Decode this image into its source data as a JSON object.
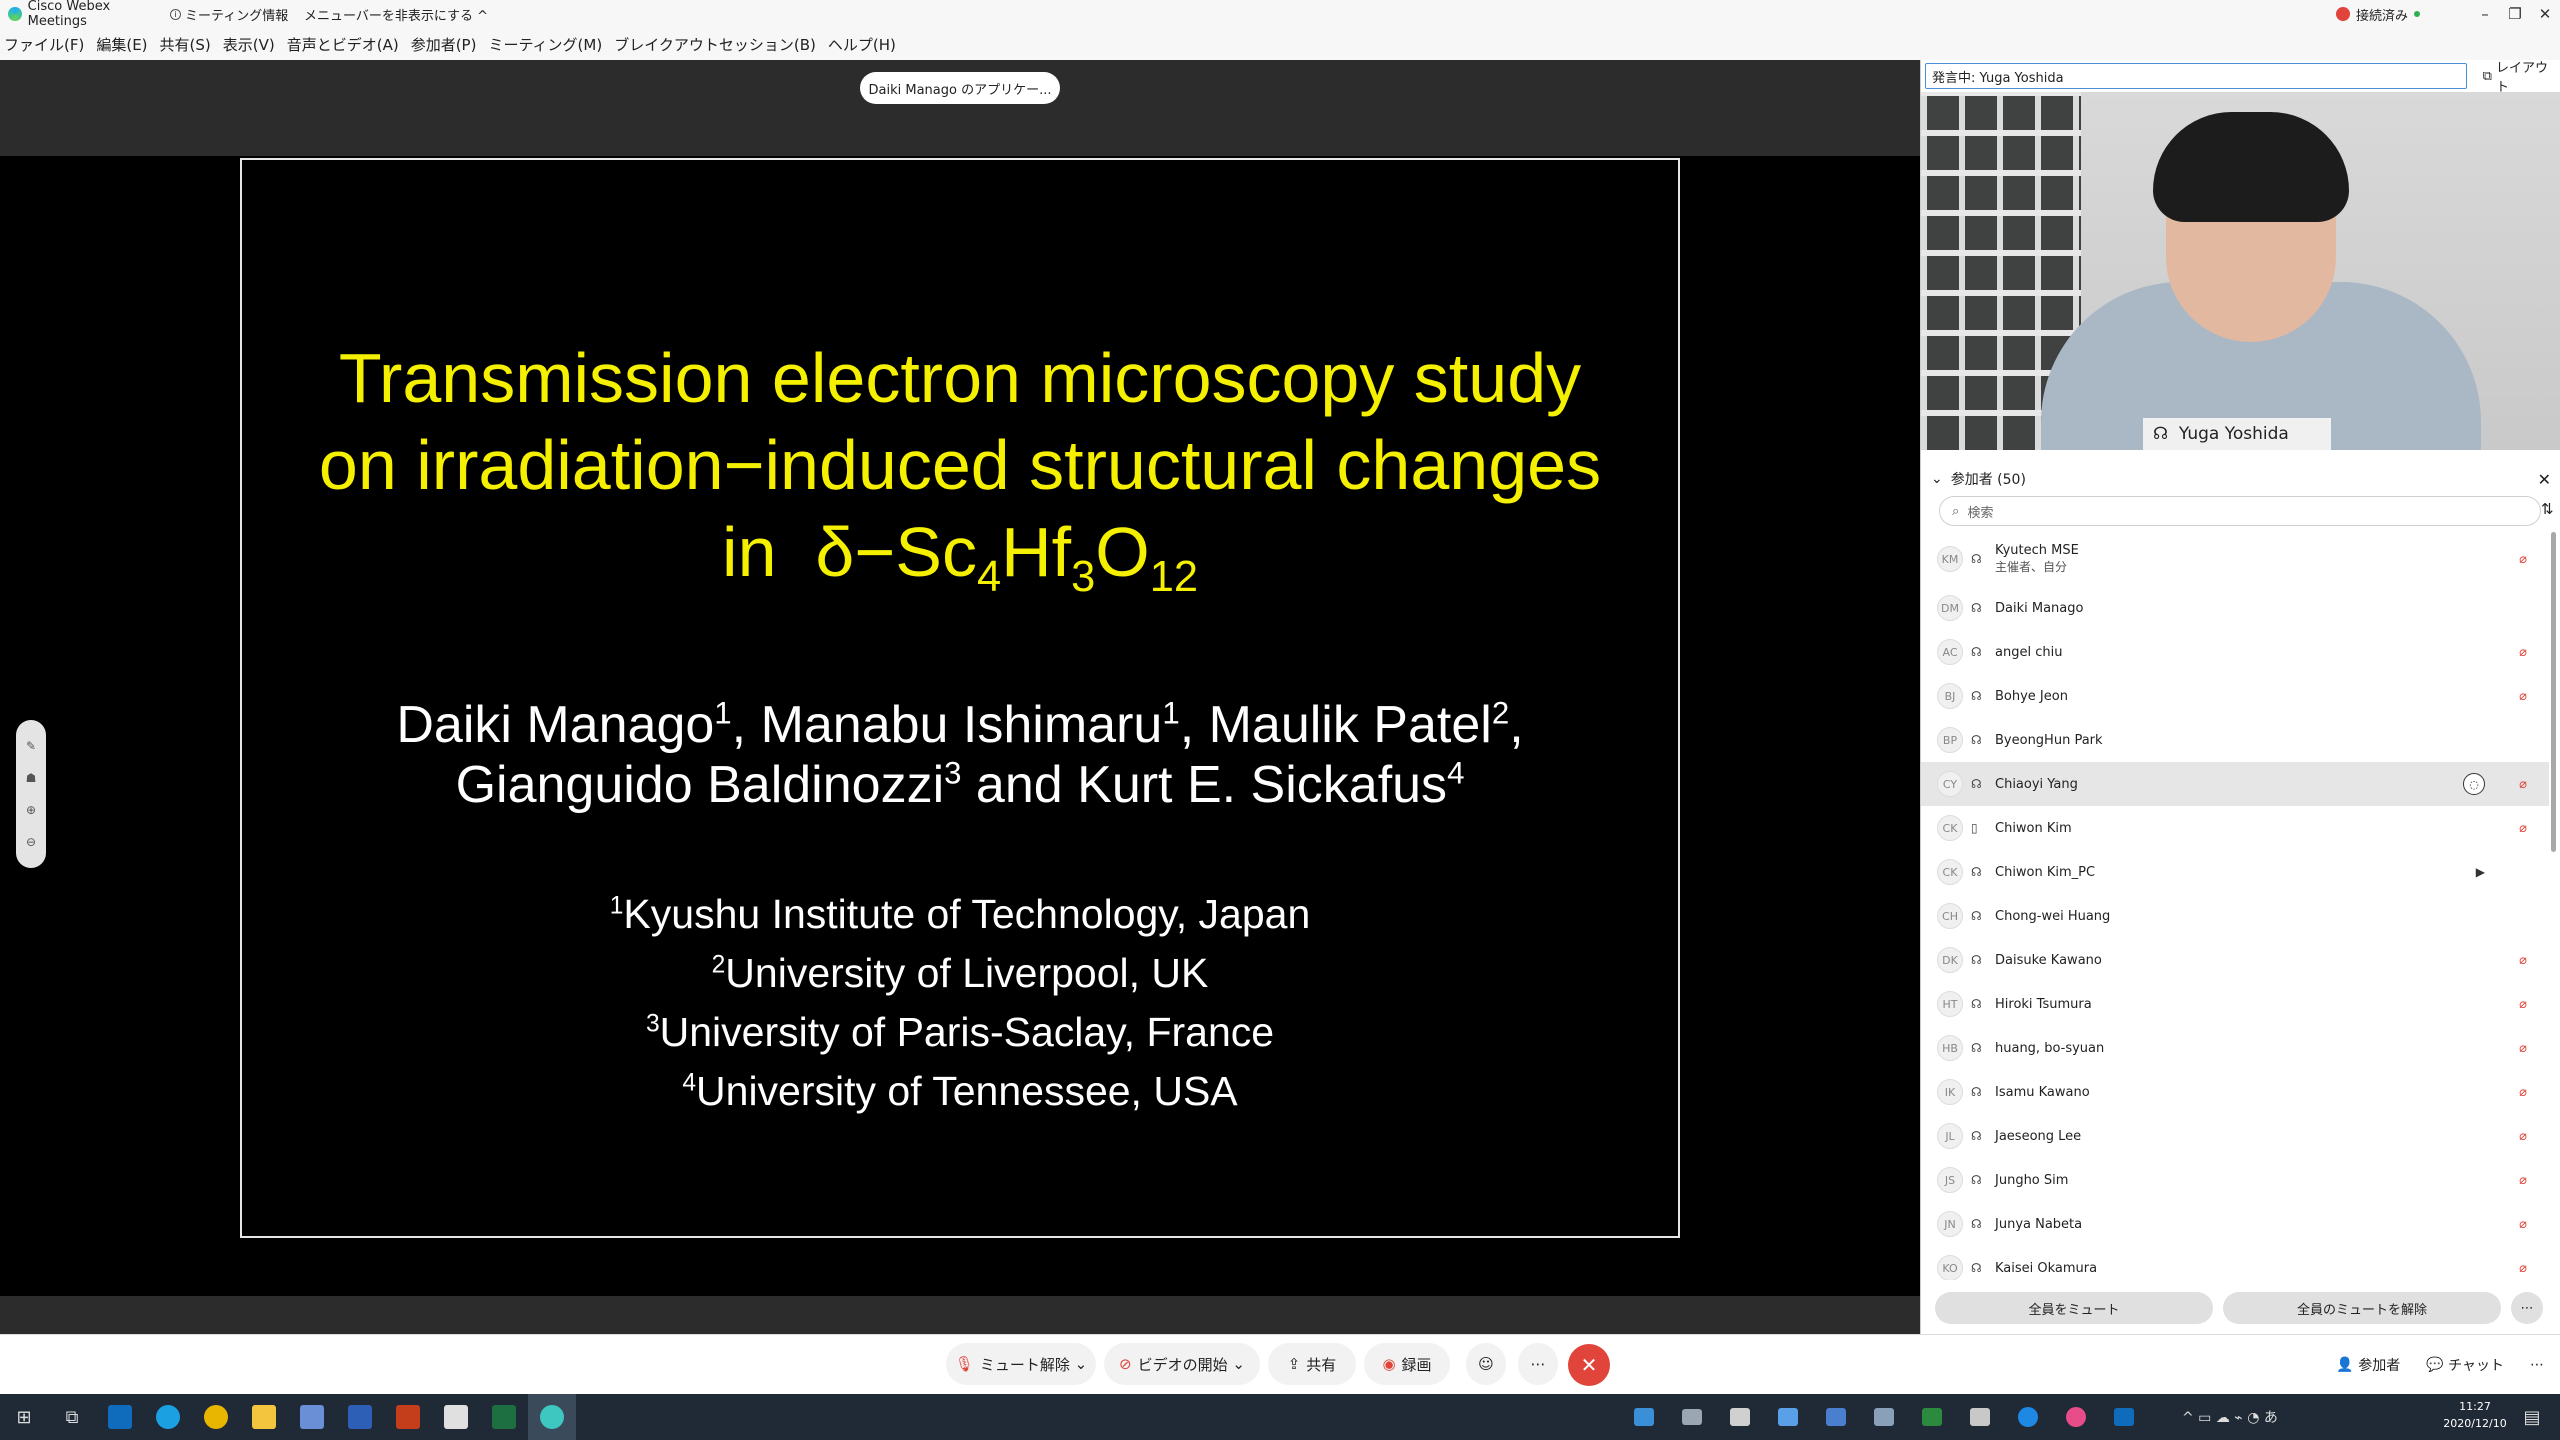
{
  "window": {
    "app_title": "Cisco Webex Meetings",
    "meeting_info": "ミーティング情報",
    "hide_menu": "メニューバーを非表示にする ^",
    "connection": "接続済み"
  },
  "menu": [
    "ファイル(F)",
    "編集(E)",
    "共有(S)",
    "表示(V)",
    "音声とビデオ(A)",
    "参加者(P)",
    "ミーティング(M)",
    "ブレイクアウトセッション(B)",
    "ヘルプ(H)"
  ],
  "share": {
    "sharer_label": "Daiki Manago のアプリケー...",
    "slide": {
      "title_line1": "Transmission electron microscopy study",
      "title_line2": "on irradiation−induced structural changes",
      "title_in": "in",
      "title_formula": "δ−Sc",
      "sub1": "4",
      "hf": "Hf",
      "sub2": "3",
      "o": "O",
      "sub3": "12",
      "authors": [
        {
          "name": "Daiki Manago",
          "sup": "1",
          "sep": ", "
        },
        {
          "name": "Manabu Ishimaru",
          "sup": "1",
          "sep": ", "
        },
        {
          "name": "Maulik Patel",
          "sup": "2",
          "sep": ","
        },
        {
          "name": "Gianguido Baldinozzi",
          "sup": "3",
          "sep": " and "
        },
        {
          "name": "Kurt E. Sickafus",
          "sup": "4",
          "sep": ""
        }
      ],
      "affiliations": [
        {
          "sup": "1",
          "text": "Kyushu Institute of Technology, Japan"
        },
        {
          "sup": "2",
          "text": "University of Liverpool, UK"
        },
        {
          "sup": "3",
          "text": "University of Paris-Saclay, France"
        },
        {
          "sup": "4",
          "text": "University of Tennessee, USA"
        }
      ]
    }
  },
  "panel": {
    "speaking": "発言中: Yuga Yoshida",
    "layout": "レイアウト",
    "video_name": "Yuga Yoshida",
    "participants_header": "参加者 (50)",
    "search_placeholder": "検索",
    "participants": [
      {
        "initials": "KM",
        "name": "Kyutech MSE",
        "role": "主催者、自分",
        "muted": true
      },
      {
        "initials": "DM",
        "name": "Daiki Manago",
        "muted": false
      },
      {
        "initials": "AC",
        "name": "angel chiu",
        "muted": true
      },
      {
        "initials": "BJ",
        "name": "Bohye Jeon",
        "muted": true
      },
      {
        "initials": "BP",
        "name": "ByeongHun Park",
        "muted": false
      },
      {
        "initials": "CY",
        "name": "Chiaoyi Yang",
        "muted": true,
        "selected": true,
        "chat": true
      },
      {
        "initials": "CK",
        "name": "Chiwon Kim",
        "muted": true,
        "phone": true
      },
      {
        "initials": "CK",
        "name": "Chiwon Kim_PC",
        "muted": false,
        "video": true
      },
      {
        "initials": "CH",
        "name": "Chong-wei Huang",
        "muted": false
      },
      {
        "initials": "DK",
        "name": "Daisuke Kawano",
        "muted": true
      },
      {
        "initials": "HT",
        "name": "Hiroki Tsumura",
        "muted": true
      },
      {
        "initials": "HB",
        "name": "huang, bo-syuan",
        "muted": true
      },
      {
        "initials": "IK",
        "name": "Isamu Kawano",
        "muted": true
      },
      {
        "initials": "JL",
        "name": "Jaeseong Lee",
        "muted": true
      },
      {
        "initials": "JS",
        "name": "Jungho Sim",
        "muted": true
      },
      {
        "initials": "JN",
        "name": "Junya Nabeta",
        "muted": true
      },
      {
        "initials": "KO",
        "name": "Kaisei Okamura",
        "muted": true
      }
    ],
    "mute_all": "全員をミュート",
    "unmute_all": "全員のミュートを解除"
  },
  "controls": {
    "unmute": "ミュート解除",
    "start_video": "ビデオの開始",
    "share": "共有",
    "record": "録画",
    "participants": "参加者",
    "chat": "チャット"
  },
  "taskbar": {
    "time": "11:27",
    "date": "2020/12/10"
  },
  "colors": {
    "slide_title": "#f4f000",
    "end_button": "#e0443a",
    "muted_icon": "#e0443a"
  }
}
